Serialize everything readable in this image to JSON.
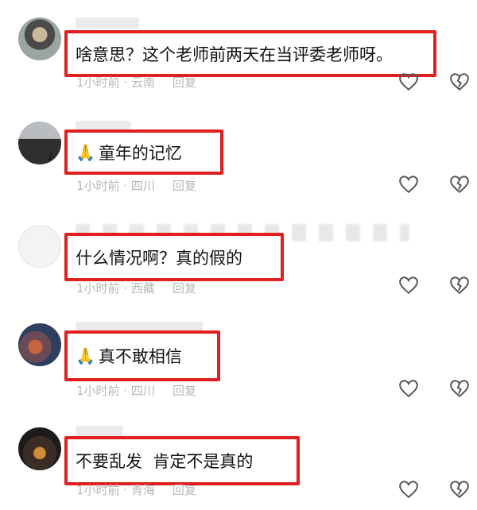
{
  "comments": [
    {
      "text": "啥意思？这个老师前两天在当评委老师呀。",
      "emoji": "",
      "time": "1小时前 · 云南",
      "reply": "回复"
    },
    {
      "text": "童年的记忆",
      "emoji": "🙏",
      "time": "1小时前 · 四川",
      "reply": "回复"
    },
    {
      "text": "什么情况啊？真的假的",
      "emoji": "",
      "time": "1小时前 · 西藏",
      "reply": "回复"
    },
    {
      "text": "真不敢相信",
      "emoji": "🙏",
      "time": "1小时前 · 四川",
      "reply": "回复"
    },
    {
      "text": "不要乱发  肯定不是真的",
      "emoji": "",
      "time": "1小时前 · 青海",
      "reply": "回复"
    }
  ],
  "colors": {
    "highlight": "#e02020",
    "icon": "#555555",
    "meta": "#b7b7b7"
  },
  "icons": {
    "like": "heart-outline-icon",
    "dislike": "broken-heart-icon"
  }
}
